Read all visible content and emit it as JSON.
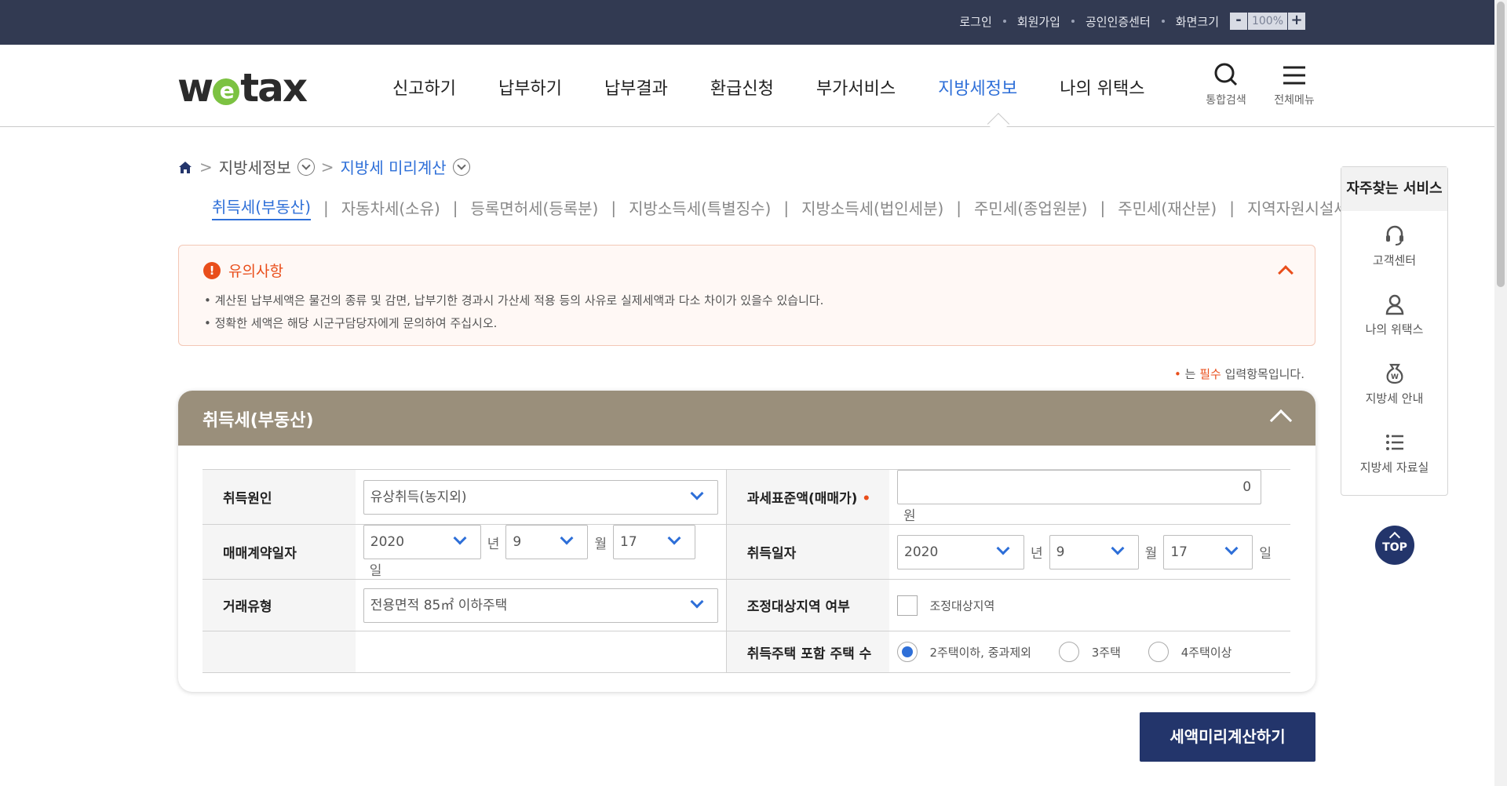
{
  "topbar": {
    "links": [
      "로그인",
      "회원가입",
      "공인인증센터",
      "화면크기"
    ],
    "zoom_minus": "-",
    "zoom_value": "100%",
    "zoom_plus": "+"
  },
  "header": {
    "logo_w": "w",
    "logo_e": "e",
    "logo_tax": "tax",
    "menu": [
      "신고하기",
      "납부하기",
      "납부결과",
      "환급신청",
      "부가서비스",
      "지방세정보",
      "나의 위택스"
    ],
    "search_label": "통합검색",
    "allmenu_label": "전체메뉴"
  },
  "breadcrumb": {
    "level1": "지방세정보",
    "level2": "지방세 미리계산"
  },
  "tabs": [
    "취득세(부동산)",
    "자동차세(소유)",
    "등록면허세(등록분)",
    "지방소득세(특별징수)",
    "지방소득세(법인세분)",
    "주민세(종업원분)",
    "주민세(재산분)",
    "지역자원시설세"
  ],
  "notice": {
    "title": "유의사항",
    "line1": "• 계산된 납부세액은 물건의 종류 및 감면, 납부기한 경과시 가산세 적용 등의 사유로 실제세액과 다소 차이가 있을수 있습니다.",
    "line2": "• 정확한 세액은 해당 시군구담당자에게 문의하여 주십시오."
  },
  "required_note": {
    "mark": "•",
    "pre": "는",
    "highlight": "필수",
    "post": "입력항목입니다."
  },
  "panel": {
    "title": "취득세(부동산)",
    "acq_cause_label": "취득원인",
    "acq_cause_value": "유상취득(농지외)",
    "tax_base_label": "과세표준액(매매가)",
    "tax_base_req": "•",
    "tax_base_value": "0",
    "won": "원",
    "contract_date_label": "매매계약일자",
    "contract_year": "2020",
    "contract_month": "9",
    "contract_day": "17",
    "acq_date_label": "취득일자",
    "acq_year": "2020",
    "acq_month": "9",
    "acq_day": "17",
    "unit_year": "년",
    "unit_month": "월",
    "unit_day": "일",
    "deal_type_label": "거래유형",
    "deal_type_value": "전용면적 85㎡ 이하주택",
    "adjust_area_label": "조정대상지역 여부",
    "adjust_area_check": "조정대상지역",
    "house_count_label": "취득주택 포함 주택 수",
    "house_opt1": "2주택이하, 중과제외",
    "house_opt2": "3주택",
    "house_opt3": "4주택이상"
  },
  "calc_button": "세액미리계산하기",
  "quick": {
    "title": "자주찾는 서비스",
    "items": [
      "고객센터",
      "나의 위택스",
      "지방세 안내",
      "지방세 자료실"
    ],
    "top": "TOP"
  },
  "colors": {
    "topbar_bg": "#323a52",
    "accent_blue": "#2e6fd8",
    "panel_header": "#9a8f7b",
    "button_navy": "#23356b",
    "warning_orange": "#e94e1b",
    "logo_green": "#7cc242"
  }
}
